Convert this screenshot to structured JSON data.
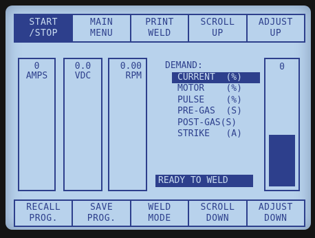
{
  "softkeys_top": [
    {
      "line1": "START",
      "line2": "/STOP",
      "active": true
    },
    {
      "line1": "MAIN",
      "line2": "MENU",
      "active": false
    },
    {
      "line1": "PRINT",
      "line2": "WELD",
      "active": false
    },
    {
      "line1": "SCROLL",
      "line2": "UP",
      "active": false
    },
    {
      "line1": "ADJUST",
      "line2": "UP",
      "active": false
    }
  ],
  "softkeys_bottom": [
    {
      "line1": "RECALL",
      "line2": "PROG.",
      "active": false
    },
    {
      "line1": "SAVE",
      "line2": "PROG.",
      "active": false
    },
    {
      "line1": "WELD",
      "line2": "MODE",
      "active": false
    },
    {
      "line1": "SCROLL",
      "line2": "DOWN",
      "active": false
    },
    {
      "line1": "ADJUST",
      "line2": "DOWN",
      "active": false
    }
  ],
  "meters": [
    {
      "value": "0",
      "unit": "AMPS"
    },
    {
      "value": "0.0",
      "unit": "VDC"
    },
    {
      "value": "0.00",
      "unit": "RPM"
    }
  ],
  "demand": {
    "title": "DEMAND:",
    "items": [
      {
        "label": "CURRENT  (%)",
        "selected": true
      },
      {
        "label": "MOTOR    (%)",
        "selected": false
      },
      {
        "label": "PULSE    (%)",
        "selected": false
      },
      {
        "label": "PRE-GAS  (S)",
        "selected": false
      },
      {
        "label": "POST-GAS(S)",
        "selected": false
      },
      {
        "label": "STRIKE   (A)",
        "selected": false
      }
    ]
  },
  "status": "READY TO WELD",
  "gauge": {
    "value": "0"
  },
  "colors": {
    "lcd_bg": "#b8d2ec",
    "ink": "#2d3f8c",
    "bezel": "#141414"
  }
}
